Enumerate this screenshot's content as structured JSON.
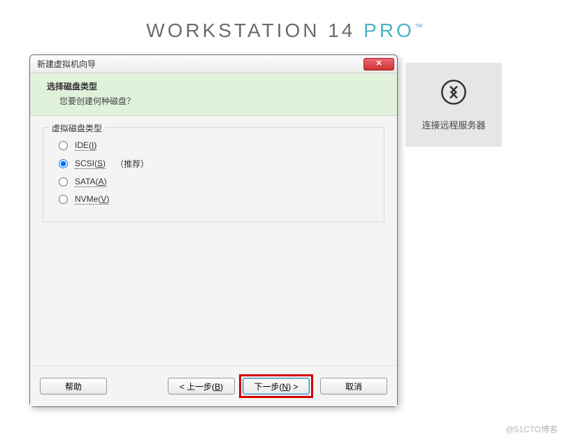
{
  "brand": {
    "name": "WORKSTATION 14 ",
    "edition": "PRO",
    "tm": "™"
  },
  "remote_tile": {
    "label": "连接远程服务器"
  },
  "dialog": {
    "title": "新建虚拟机向导",
    "heading": "选择磁盘类型",
    "subheading": "您要创建何种磁盘？",
    "group_label": "虚拟磁盘类型",
    "options": {
      "ide": {
        "label": "IDE(",
        "mn": "I",
        "suffix": ")"
      },
      "scsi": {
        "label": "SCSI(",
        "mn": "S",
        "suffix": ")",
        "hint": "（推荐）"
      },
      "sata": {
        "label": "SATA(",
        "mn": "A",
        "suffix": ")"
      },
      "nvme": {
        "label": "NVMe(",
        "mn": "V",
        "suffix": ")"
      }
    },
    "selected": "scsi",
    "buttons": {
      "help": "帮助",
      "back_pre": "< 上一步(",
      "back_mn": "B",
      "back_suf": ")",
      "next_pre": "下一步(",
      "next_mn": "N",
      "next_suf": ") >",
      "cancel": "取消"
    }
  },
  "watermark": "@51CTO博客"
}
